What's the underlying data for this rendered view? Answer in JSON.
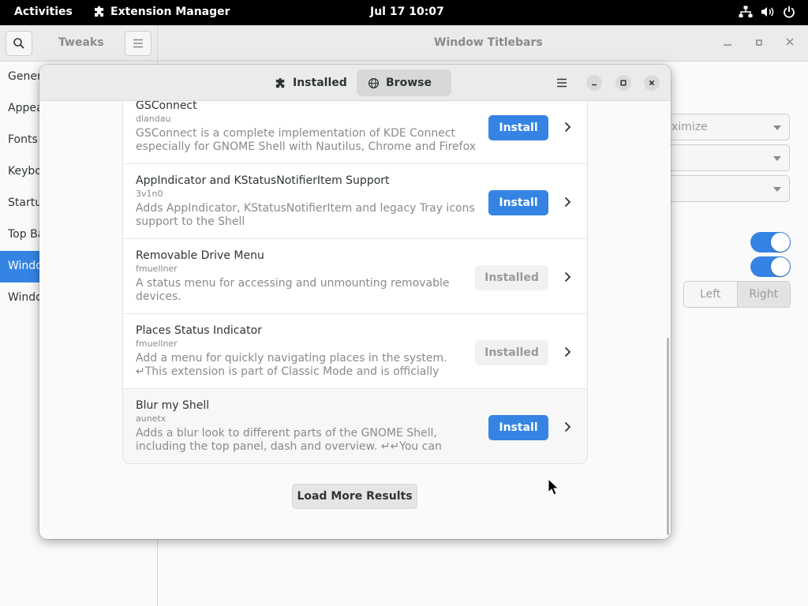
{
  "topbar": {
    "activities": "Activities",
    "app_name": "Extension Manager",
    "clock": "Jul 17  10:07"
  },
  "tweaks": {
    "header_left_title": "Tweaks",
    "header_right_title": "Window Titlebars",
    "sidebar": [
      {
        "label": "Gener",
        "selected": false
      },
      {
        "label": "Appea",
        "selected": false
      },
      {
        "label": "Fonts",
        "selected": false
      },
      {
        "label": "Keybo",
        "selected": false
      },
      {
        "label": "Startu",
        "selected": false
      },
      {
        "label": "Top Ba",
        "selected": false
      },
      {
        "label": "Windo",
        "selected": true
      },
      {
        "label": "Windo",
        "selected": false
      }
    ],
    "combo_1_value": "ximize",
    "combo_2_value": "",
    "combo_3_value": "",
    "toggle_1_on": true,
    "toggle_2_on": true,
    "placement_left": "Left",
    "placement_right": "Right",
    "accent_color": "#3584e4"
  },
  "extension_manager": {
    "tabs": {
      "installed_label": "Installed",
      "browse_label": "Browse",
      "active": "Browse"
    },
    "results": [
      {
        "name": "GSConnect",
        "creator": "dlandau",
        "description": "GSConnect is a complete implementation of KDE Connect especially for GNOME Shell with Nautilus, Chrome and Firefox i…",
        "action": "Install"
      },
      {
        "name": "AppIndicator and KStatusNotifierItem Support",
        "creator": "3v1n0",
        "description": "Adds AppIndicator, KStatusNotifierItem and legacy Tray icons support to the Shell",
        "action": "Install"
      },
      {
        "name": "Removable Drive Menu",
        "creator": "fmuellner",
        "description": "A status menu for accessing and unmounting removable devices.",
        "action": "Installed"
      },
      {
        "name": "Places Status Indicator",
        "creator": "fmuellner",
        "description": "Add a menu for quickly navigating places in the system. ↵This extension is part of Classic Mode and is officially supported by…",
        "action": "Installed"
      },
      {
        "name": "Blur my Shell",
        "creator": "aunetx",
        "description": "Adds a blur look to different parts of the GNOME Shell, including the top panel, dash and overview. ↵↵You can support my work by…",
        "action": "Install"
      }
    ],
    "load_more_label": "Load More Results"
  }
}
